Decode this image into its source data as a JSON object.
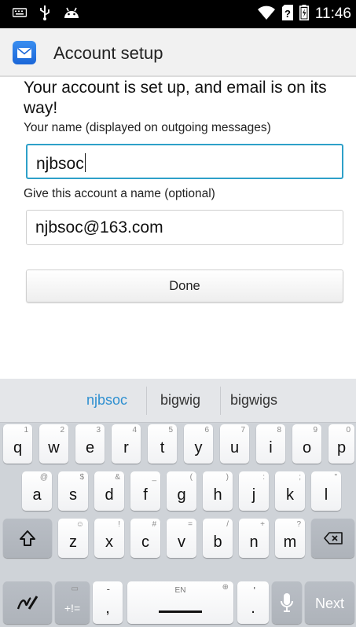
{
  "status_bar": {
    "time": "11:46",
    "left_icons": [
      "keyboard-icon",
      "usb-icon",
      "android-icon"
    ],
    "right_icons": [
      "wifi-icon",
      "sim-question-icon",
      "battery-icon"
    ]
  },
  "action_bar": {
    "title": "Account setup",
    "app_icon": "email-app-icon",
    "accent": "#1a66d8"
  },
  "content": {
    "headline": "Your account is set up, and email is on its way!",
    "your_name_label": "Your name (displayed on outgoing messages)",
    "your_name_value": "njbsoc",
    "account_name_label": "Give this account a name (optional)",
    "account_name_value": "njbsoc@163.com",
    "done_label": "Done",
    "focus_color": "#2ea0c9"
  },
  "keyboard": {
    "suggestions": [
      "njbsoc",
      "bigwig",
      "bigwigs"
    ],
    "row1": [
      {
        "main": "q",
        "hint": "1"
      },
      {
        "main": "w",
        "hint": "2"
      },
      {
        "main": "e",
        "hint": "3"
      },
      {
        "main": "r",
        "hint": "4"
      },
      {
        "main": "t",
        "hint": "5"
      },
      {
        "main": "y",
        "hint": "6"
      },
      {
        "main": "u",
        "hint": "7"
      },
      {
        "main": "i",
        "hint": "8"
      },
      {
        "main": "o",
        "hint": "9"
      },
      {
        "main": "p",
        "hint": "0"
      }
    ],
    "row2": [
      {
        "main": "a",
        "hint": "@"
      },
      {
        "main": "s",
        "hint": "$"
      },
      {
        "main": "d",
        "hint": "&"
      },
      {
        "main": "f",
        "hint": "_"
      },
      {
        "main": "g",
        "hint": "("
      },
      {
        "main": "h",
        "hint": ")"
      },
      {
        "main": "j",
        "hint": ":"
      },
      {
        "main": "k",
        "hint": ";"
      },
      {
        "main": "l",
        "hint": "\""
      }
    ],
    "row3": [
      {
        "main": "z",
        "hint": "☺"
      },
      {
        "main": "x",
        "hint": "!"
      },
      {
        "main": "c",
        "hint": "#"
      },
      {
        "main": "v",
        "hint": "="
      },
      {
        "main": "b",
        "hint": "/"
      },
      {
        "main": "n",
        "hint": "+"
      },
      {
        "main": "m",
        "hint": "?"
      }
    ],
    "symbols_label": "+!=",
    "comma_label": ",",
    "space_label": "EN",
    "period_label": ".",
    "apostrophe_label": "'",
    "dash_label": "-",
    "next_label": "Next"
  }
}
